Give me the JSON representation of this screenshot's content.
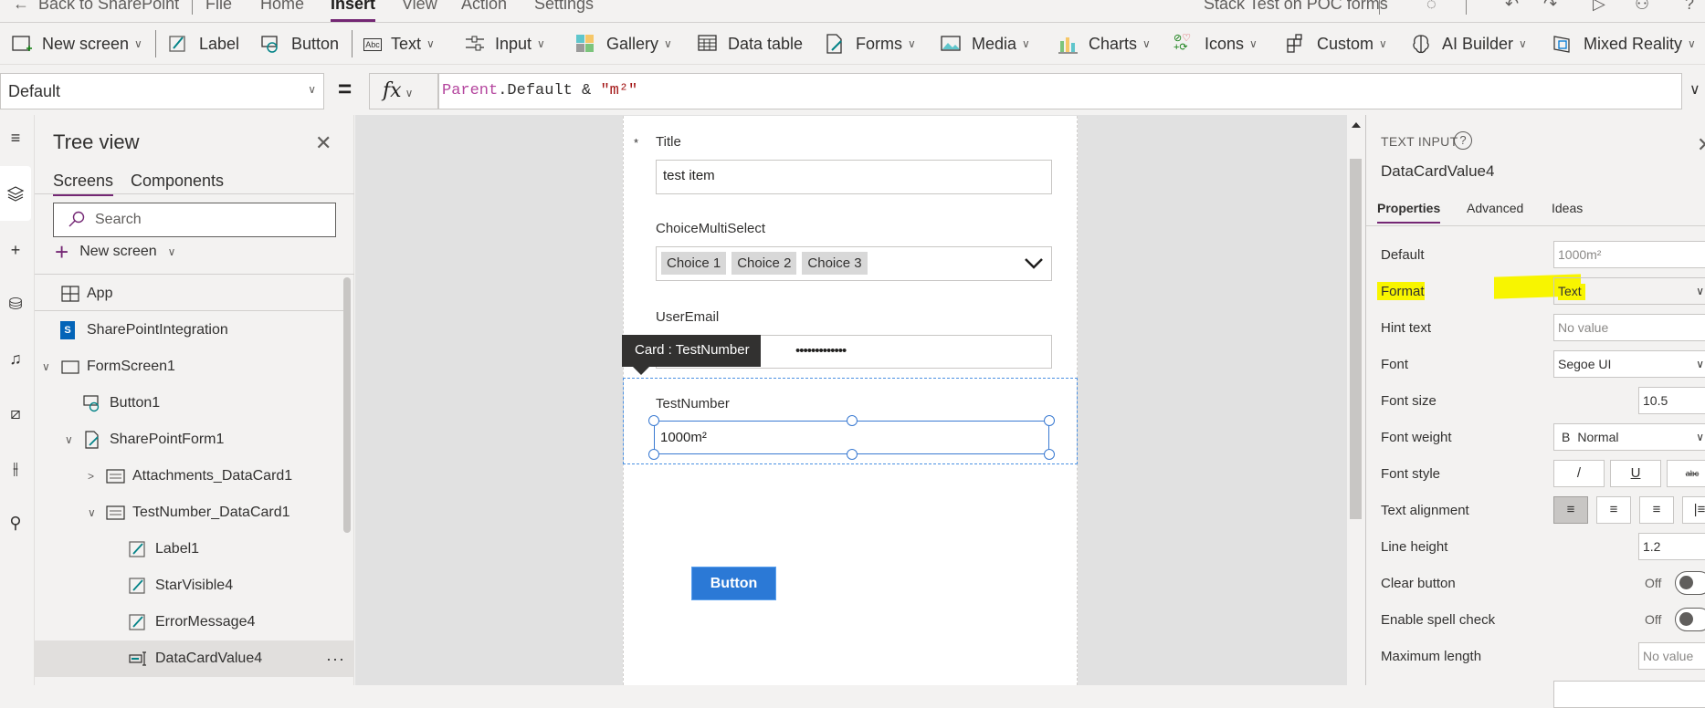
{
  "menubar": {
    "back_label": "Back to SharePoint",
    "items": [
      "File",
      "Home",
      "Insert",
      "View",
      "Action",
      "Settings"
    ],
    "active": "Insert",
    "app_title": "Stack Test on POC forms"
  },
  "toolbar": {
    "items": [
      {
        "label": "New screen",
        "icon": "new-screen-icon",
        "dropdown": true
      },
      {
        "label": "Label",
        "icon": "label-pencil-icon",
        "dropdown": false
      },
      {
        "label": "Button",
        "icon": "button-hand-icon",
        "dropdown": false
      },
      {
        "label": "Text",
        "icon": "abc-text-icon",
        "dropdown": true
      },
      {
        "label": "Input",
        "icon": "input-sliders-icon",
        "dropdown": true
      },
      {
        "label": "Gallery",
        "icon": "gallery-grid-icon",
        "dropdown": true
      },
      {
        "label": "Data table",
        "icon": "data-table-icon",
        "dropdown": false
      },
      {
        "label": "Forms",
        "icon": "forms-icon",
        "dropdown": true
      },
      {
        "label": "Media",
        "icon": "media-image-icon",
        "dropdown": true
      },
      {
        "label": "Charts",
        "icon": "charts-bar-icon",
        "dropdown": true
      },
      {
        "label": "Icons",
        "icon": "icons-icon",
        "dropdown": true
      },
      {
        "label": "Custom",
        "icon": "custom-component-icon",
        "dropdown": true
      },
      {
        "label": "AI Builder",
        "icon": "ai-brain-icon",
        "dropdown": true
      },
      {
        "label": "Mixed Reality",
        "icon": "mixed-reality-cube-icon",
        "dropdown": true
      }
    ]
  },
  "formula_bar": {
    "property": "Default",
    "fx_label": "fx",
    "formula_parts": [
      {
        "text": "Parent",
        "kind": "keyword"
      },
      {
        "text": ".Default & ",
        "kind": "plain"
      },
      {
        "text": "\"m²\"",
        "kind": "string"
      }
    ]
  },
  "tree_view": {
    "title": "Tree view",
    "tabs": [
      "Screens",
      "Components"
    ],
    "active_tab": "Screens",
    "search_placeholder": "Search",
    "new_screen_label": "New screen",
    "items": [
      {
        "label": "App",
        "icon": "app-grid-icon",
        "depth": 0,
        "expander": "none"
      },
      {
        "label": "SharePointIntegration",
        "icon": "sharepoint-icon",
        "depth": 0,
        "expander": "none"
      },
      {
        "label": "FormScreen1",
        "icon": "screen-icon",
        "depth": 0,
        "expander": "expanded"
      },
      {
        "label": "Button1",
        "icon": "button-hand-icon",
        "depth": 1,
        "expander": "none"
      },
      {
        "label": "SharePointForm1",
        "icon": "form-icon",
        "depth": 1,
        "expander": "expanded"
      },
      {
        "label": "Attachments_DataCard1",
        "icon": "datacard-icon",
        "depth": 2,
        "expander": "collapsed"
      },
      {
        "label": "TestNumber_DataCard1",
        "icon": "datacard-icon",
        "depth": 2,
        "expander": "expanded"
      },
      {
        "label": "Label1",
        "icon": "label-pencil-icon",
        "depth": 3,
        "expander": "none"
      },
      {
        "label": "StarVisible4",
        "icon": "label-pencil-icon",
        "depth": 3,
        "expander": "none"
      },
      {
        "label": "ErrorMessage4",
        "icon": "label-pencil-icon",
        "depth": 3,
        "expander": "none"
      },
      {
        "label": "DataCardValue4",
        "icon": "text-input-icon",
        "depth": 3,
        "expander": "none",
        "selected": true
      }
    ]
  },
  "form": {
    "fields": [
      {
        "label": "Title",
        "required": true,
        "value": "test item"
      },
      {
        "label": "ChoiceMultiSelect",
        "required": false,
        "chips": [
          "Choice 1",
          "Choice 2",
          "Choice 3"
        ]
      },
      {
        "label": "UserEmail",
        "required": false,
        "value": "•••••••••••••"
      },
      {
        "label": "TestNumber",
        "required": false,
        "value": "1000m²"
      }
    ],
    "tooltip": "Card : TestNumber",
    "button_label": "Button"
  },
  "properties_panel": {
    "control_type": "TEXT INPUT",
    "help_label": "?",
    "control_name": "DataCardValue4",
    "tabs": [
      "Properties",
      "Advanced",
      "Ideas"
    ],
    "active_tab": "Properties",
    "rows": {
      "default": {
        "label": "Default",
        "value": "1000m²"
      },
      "format": {
        "label": "Format",
        "value": "Text"
      },
      "hint_text": {
        "label": "Hint text",
        "placeholder": "No value"
      },
      "font": {
        "label": "Font",
        "value": "Segoe UI"
      },
      "font_size": {
        "label": "Font size",
        "value": "10.5"
      },
      "font_weight": {
        "label": "Font weight",
        "value": "Normal",
        "prefix": "B"
      },
      "font_style": {
        "label": "Font style",
        "buttons": [
          "/",
          "U",
          "abc"
        ]
      },
      "text_alignment": {
        "label": "Text alignment",
        "active": "left"
      },
      "line_height": {
        "label": "Line height",
        "value": "1.2"
      },
      "clear_button": {
        "label": "Clear button",
        "state": "Off"
      },
      "spell_check": {
        "label": "Enable spell check",
        "state": "Off"
      },
      "max_length": {
        "label": "Maximum length",
        "placeholder": "No value"
      }
    },
    "highlight_color": "#f8f500"
  }
}
